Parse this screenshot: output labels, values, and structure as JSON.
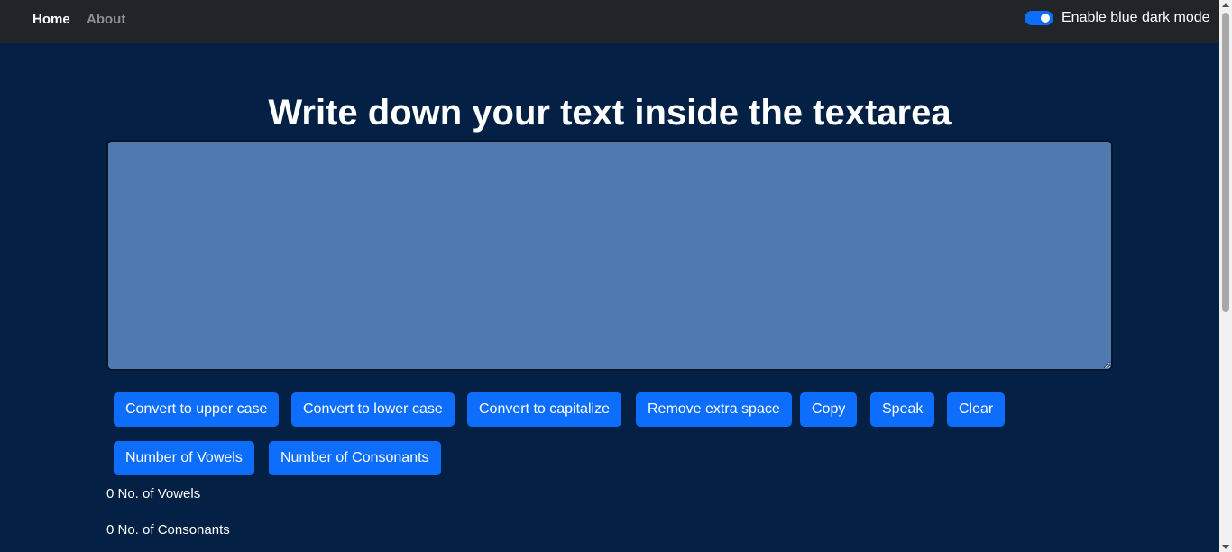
{
  "nav": {
    "home": "Home",
    "about": "About",
    "toggle_label": "Enable blue dark mode",
    "toggle_on": true
  },
  "main": {
    "heading": "Write down your text inside the textarea",
    "textarea_value": "",
    "buttons": [
      "Convert to upper case",
      "Convert to lower case",
      "Convert to capitalize",
      "Remove extra space",
      "Copy",
      "Speak",
      "Clear",
      "Number of Vowels",
      "Number of Consonants"
    ],
    "vowels_count": "0 No. of Vowels",
    "consonants_count": "0 No. of Consonants"
  },
  "colors": {
    "background": "#042045",
    "navbar": "#212529",
    "accent": "#0d6efd",
    "textarea": "#4e79b1"
  }
}
